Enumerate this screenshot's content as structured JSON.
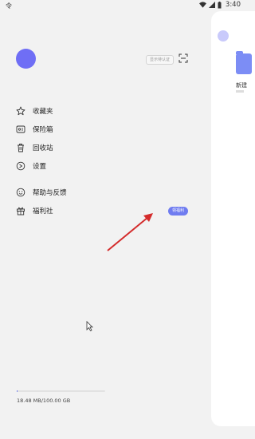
{
  "status_bar": {
    "left_text": "令",
    "time": "3:40"
  },
  "drawer": {
    "verify_tag": "显示待认证",
    "menu": [
      {
        "label": "收藏夹",
        "icon": "star-icon"
      },
      {
        "label": "保险箱",
        "icon": "safe-icon"
      },
      {
        "label": "回收站",
        "icon": "trash-icon"
      },
      {
        "label": "设置",
        "icon": "settings-icon"
      },
      {
        "label": "帮助与反馈",
        "icon": "smile-icon"
      },
      {
        "label": "福利社",
        "icon": "gift-icon"
      }
    ],
    "promo_badge": "领福利",
    "storage": {
      "text": "18.48 MB/100.00 GB",
      "used_fraction": 0.0002
    }
  },
  "main": {
    "folder_name": "新建"
  },
  "colors": {
    "accent": "#6f7cf0",
    "avatar": "#6f6ef5",
    "arrow": "#d42b2b"
  }
}
